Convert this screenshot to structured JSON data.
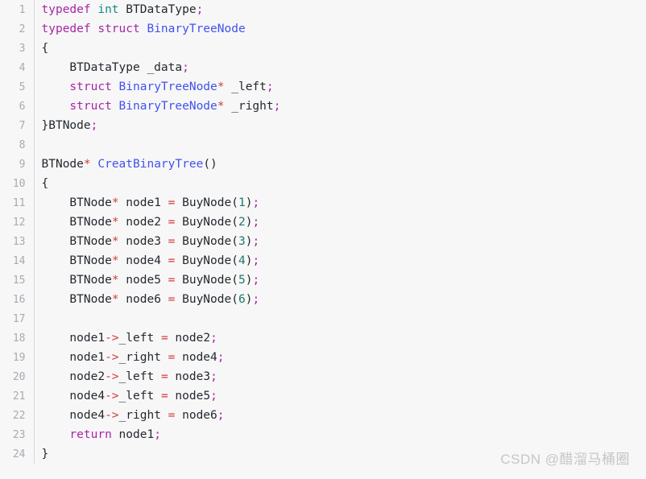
{
  "editor": {
    "language": "c",
    "background_color": "#f7f7f8",
    "gutter_color": "#a9a9b3",
    "text_color": "#24292e",
    "keyword_color": "#a626a4",
    "type_color": "#0e8f7e",
    "class_color": "#4152ea",
    "number_color": "#1d7a63",
    "operator_color": "#d13c35"
  },
  "watermark": {
    "text": "CSDN @醋溜马桶圈"
  },
  "lines": [
    {
      "number": "1",
      "tokens": [
        {
          "t": "typedef",
          "c": "tok-keyword"
        },
        {
          "t": " ",
          "c": "tok-plain"
        },
        {
          "t": "int",
          "c": "tok-type"
        },
        {
          "t": " BTDataType",
          "c": "tok-plain"
        },
        {
          "t": ";",
          "c": "tok-punc"
        }
      ]
    },
    {
      "number": "2",
      "tokens": [
        {
          "t": "typedef",
          "c": "tok-keyword"
        },
        {
          "t": " ",
          "c": "tok-plain"
        },
        {
          "t": "struct",
          "c": "tok-keyword"
        },
        {
          "t": " ",
          "c": "tok-plain"
        },
        {
          "t": "BinaryTreeNode",
          "c": "tok-class"
        }
      ]
    },
    {
      "number": "3",
      "tokens": [
        {
          "t": "{",
          "c": "tok-plain"
        }
      ]
    },
    {
      "number": "4",
      "tokens": [
        {
          "t": "    BTDataType _data",
          "c": "tok-plain"
        },
        {
          "t": ";",
          "c": "tok-punc"
        }
      ]
    },
    {
      "number": "5",
      "tokens": [
        {
          "t": "    ",
          "c": "tok-plain"
        },
        {
          "t": "struct",
          "c": "tok-keyword"
        },
        {
          "t": " ",
          "c": "tok-plain"
        },
        {
          "t": "BinaryTreeNode",
          "c": "tok-class"
        },
        {
          "t": "*",
          "c": "tok-op"
        },
        {
          "t": " _left",
          "c": "tok-plain"
        },
        {
          "t": ";",
          "c": "tok-punc"
        }
      ]
    },
    {
      "number": "6",
      "tokens": [
        {
          "t": "    ",
          "c": "tok-plain"
        },
        {
          "t": "struct",
          "c": "tok-keyword"
        },
        {
          "t": " ",
          "c": "tok-plain"
        },
        {
          "t": "BinaryTreeNode",
          "c": "tok-class"
        },
        {
          "t": "*",
          "c": "tok-op"
        },
        {
          "t": " _right",
          "c": "tok-plain"
        },
        {
          "t": ";",
          "c": "tok-punc"
        }
      ]
    },
    {
      "number": "7",
      "tokens": [
        {
          "t": "}BTNode",
          "c": "tok-plain"
        },
        {
          "t": ";",
          "c": "tok-punc"
        }
      ]
    },
    {
      "number": "8",
      "tokens": []
    },
    {
      "number": "9",
      "tokens": [
        {
          "t": "BTNode",
          "c": "tok-plain"
        },
        {
          "t": "*",
          "c": "tok-op"
        },
        {
          "t": " ",
          "c": "tok-plain"
        },
        {
          "t": "CreatBinaryTree",
          "c": "tok-func"
        },
        {
          "t": "()",
          "c": "tok-plain"
        }
      ]
    },
    {
      "number": "10",
      "tokens": [
        {
          "t": "{",
          "c": "tok-plain"
        }
      ]
    },
    {
      "number": "11",
      "tokens": [
        {
          "t": "    BTNode",
          "c": "tok-plain"
        },
        {
          "t": "*",
          "c": "tok-op"
        },
        {
          "t": " node1 ",
          "c": "tok-plain"
        },
        {
          "t": "=",
          "c": "tok-op"
        },
        {
          "t": " BuyNode(",
          "c": "tok-plain"
        },
        {
          "t": "1",
          "c": "tok-num"
        },
        {
          "t": ")",
          "c": "tok-plain"
        },
        {
          "t": ";",
          "c": "tok-punc"
        }
      ]
    },
    {
      "number": "12",
      "tokens": [
        {
          "t": "    BTNode",
          "c": "tok-plain"
        },
        {
          "t": "*",
          "c": "tok-op"
        },
        {
          "t": " node2 ",
          "c": "tok-plain"
        },
        {
          "t": "=",
          "c": "tok-op"
        },
        {
          "t": " BuyNode(",
          "c": "tok-plain"
        },
        {
          "t": "2",
          "c": "tok-num"
        },
        {
          "t": ")",
          "c": "tok-plain"
        },
        {
          "t": ";",
          "c": "tok-punc"
        }
      ]
    },
    {
      "number": "13",
      "tokens": [
        {
          "t": "    BTNode",
          "c": "tok-plain"
        },
        {
          "t": "*",
          "c": "tok-op"
        },
        {
          "t": " node3 ",
          "c": "tok-plain"
        },
        {
          "t": "=",
          "c": "tok-op"
        },
        {
          "t": " BuyNode(",
          "c": "tok-plain"
        },
        {
          "t": "3",
          "c": "tok-num"
        },
        {
          "t": ")",
          "c": "tok-plain"
        },
        {
          "t": ";",
          "c": "tok-punc"
        }
      ]
    },
    {
      "number": "14",
      "tokens": [
        {
          "t": "    BTNode",
          "c": "tok-plain"
        },
        {
          "t": "*",
          "c": "tok-op"
        },
        {
          "t": " node4 ",
          "c": "tok-plain"
        },
        {
          "t": "=",
          "c": "tok-op"
        },
        {
          "t": " BuyNode(",
          "c": "tok-plain"
        },
        {
          "t": "4",
          "c": "tok-num"
        },
        {
          "t": ")",
          "c": "tok-plain"
        },
        {
          "t": ";",
          "c": "tok-punc"
        }
      ]
    },
    {
      "number": "15",
      "tokens": [
        {
          "t": "    BTNode",
          "c": "tok-plain"
        },
        {
          "t": "*",
          "c": "tok-op"
        },
        {
          "t": " node5 ",
          "c": "tok-plain"
        },
        {
          "t": "=",
          "c": "tok-op"
        },
        {
          "t": " BuyNode(",
          "c": "tok-plain"
        },
        {
          "t": "5",
          "c": "tok-num"
        },
        {
          "t": ")",
          "c": "tok-plain"
        },
        {
          "t": ";",
          "c": "tok-punc"
        }
      ]
    },
    {
      "number": "16",
      "tokens": [
        {
          "t": "    BTNode",
          "c": "tok-plain"
        },
        {
          "t": "*",
          "c": "tok-op"
        },
        {
          "t": " node6 ",
          "c": "tok-plain"
        },
        {
          "t": "=",
          "c": "tok-op"
        },
        {
          "t": " BuyNode(",
          "c": "tok-plain"
        },
        {
          "t": "6",
          "c": "tok-num"
        },
        {
          "t": ")",
          "c": "tok-plain"
        },
        {
          "t": ";",
          "c": "tok-punc"
        }
      ]
    },
    {
      "number": "17",
      "tokens": []
    },
    {
      "number": "18",
      "tokens": [
        {
          "t": "    node1",
          "c": "tok-plain"
        },
        {
          "t": "->",
          "c": "tok-op"
        },
        {
          "t": "_left ",
          "c": "tok-plain"
        },
        {
          "t": "=",
          "c": "tok-op"
        },
        {
          "t": " node2",
          "c": "tok-plain"
        },
        {
          "t": ";",
          "c": "tok-punc"
        }
      ]
    },
    {
      "number": "19",
      "tokens": [
        {
          "t": "    node1",
          "c": "tok-plain"
        },
        {
          "t": "->",
          "c": "tok-op"
        },
        {
          "t": "_right ",
          "c": "tok-plain"
        },
        {
          "t": "=",
          "c": "tok-op"
        },
        {
          "t": " node4",
          "c": "tok-plain"
        },
        {
          "t": ";",
          "c": "tok-punc"
        }
      ]
    },
    {
      "number": "20",
      "tokens": [
        {
          "t": "    node2",
          "c": "tok-plain"
        },
        {
          "t": "->",
          "c": "tok-op"
        },
        {
          "t": "_left ",
          "c": "tok-plain"
        },
        {
          "t": "=",
          "c": "tok-op"
        },
        {
          "t": " node3",
          "c": "tok-plain"
        },
        {
          "t": ";",
          "c": "tok-punc"
        }
      ]
    },
    {
      "number": "21",
      "tokens": [
        {
          "t": "    node4",
          "c": "tok-plain"
        },
        {
          "t": "->",
          "c": "tok-op"
        },
        {
          "t": "_left ",
          "c": "tok-plain"
        },
        {
          "t": "=",
          "c": "tok-op"
        },
        {
          "t": " node5",
          "c": "tok-plain"
        },
        {
          "t": ";",
          "c": "tok-punc"
        }
      ]
    },
    {
      "number": "22",
      "tokens": [
        {
          "t": "    node4",
          "c": "tok-plain"
        },
        {
          "t": "->",
          "c": "tok-op"
        },
        {
          "t": "_right ",
          "c": "tok-plain"
        },
        {
          "t": "=",
          "c": "tok-op"
        },
        {
          "t": " node6",
          "c": "tok-plain"
        },
        {
          "t": ";",
          "c": "tok-punc"
        }
      ]
    },
    {
      "number": "23",
      "tokens": [
        {
          "t": "    ",
          "c": "tok-plain"
        },
        {
          "t": "return",
          "c": "tok-keyword"
        },
        {
          "t": " node1",
          "c": "tok-plain"
        },
        {
          "t": ";",
          "c": "tok-punc"
        }
      ]
    },
    {
      "number": "24",
      "tokens": [
        {
          "t": "}",
          "c": "tok-plain"
        }
      ]
    }
  ]
}
